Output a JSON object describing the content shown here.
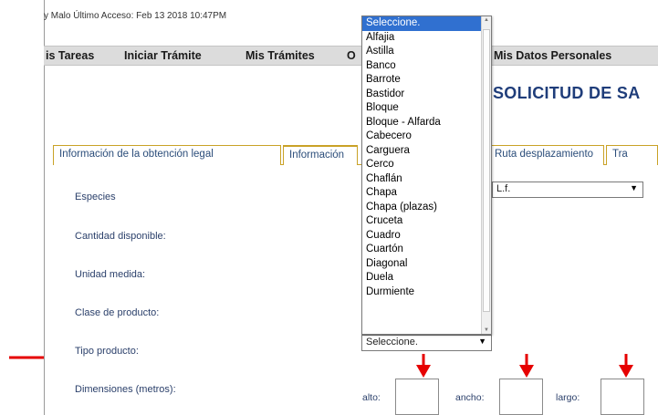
{
  "header": {
    "last_access": "y Malo Último Acceso: Feb 13 2018 10:47PM"
  },
  "menu": {
    "items": [
      "is Tareas",
      "Iniciar Trámite",
      "Mis Trámites",
      "O",
      "Mis Datos Personales"
    ]
  },
  "page": {
    "title": "SOLICITUD DE SA"
  },
  "tabs": [
    "Información de la obtención legal",
    "Información",
    "Ruta desplazamiento",
    "Tra"
  ],
  "form": {
    "labels": {
      "especies": "Especies",
      "cantidad": "Cantidad disponible:",
      "unidad": "Unidad medida:",
      "clase": "Clase de producto:",
      "tipo": "Tipo producto:",
      "dimensiones": "Dimensiones (metros):"
    },
    "especies_value": "L.f.",
    "tipo_value": "Seleccione.",
    "dims": {
      "alto": "alto:",
      "ancho": "ancho:",
      "largo": "largo:"
    }
  },
  "dropdown": {
    "selected_index": 0,
    "options": [
      "Seleccione.",
      "Alfajia",
      "Astilla",
      "Banco",
      "Barrote",
      "Bastidor",
      "Bloque",
      "Bloque - Alfarda",
      "Cabecero",
      "Carguera",
      "Cerco",
      "Chaflán",
      "Chapa",
      "Chapa (plazas)",
      "Cruceta",
      "Cuadro",
      "Cuartón",
      "Diagonal",
      "Duela",
      "Durmiente"
    ]
  },
  "colors": {
    "annotation": "#e60000",
    "tab_border": "#c9a227",
    "title": "#1f3d7a",
    "selected": "#3070d0"
  }
}
